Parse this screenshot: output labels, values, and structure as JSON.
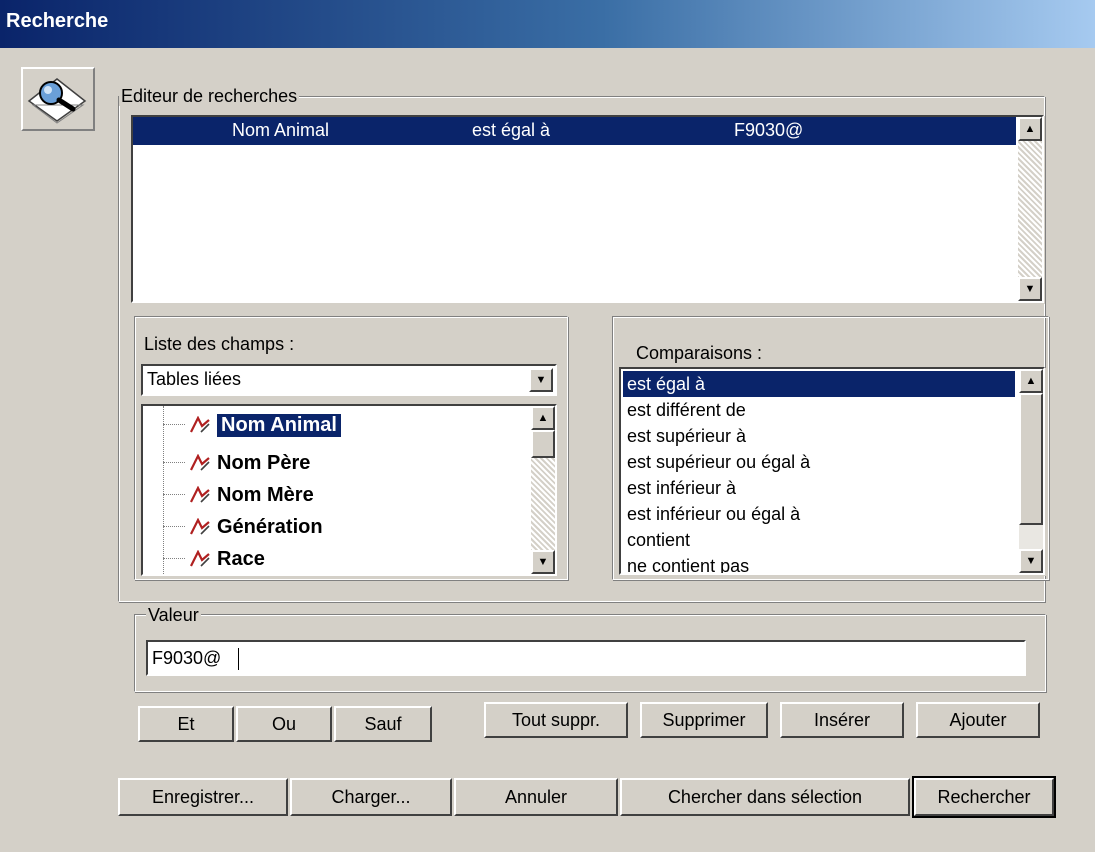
{
  "window": {
    "title": "Recherche"
  },
  "editor": {
    "label": "Editeur de recherches",
    "rows": [
      {
        "field": "Nom Animal",
        "operator": "est égal à",
        "value": "F9030@"
      }
    ]
  },
  "fields": {
    "label": "Liste des champs :",
    "dropdown_value": "Tables liées",
    "items": [
      "Nom Animal",
      "Nom Père",
      "Nom Mère",
      "Génération",
      "Race"
    ]
  },
  "comparisons": {
    "label": "Comparaisons :",
    "items": [
      "est égal à",
      "est différent de",
      "est supérieur à",
      "est supérieur ou égal à",
      "est inférieur à",
      "est inférieur ou égal à",
      "contient",
      "ne contient pas"
    ]
  },
  "value_group": {
    "label": "Valeur",
    "value": "F9030@"
  },
  "logic_buttons": {
    "et": "Et",
    "ou": "Ou",
    "sauf": "Sauf"
  },
  "edit_buttons": {
    "tout_suppr": "Tout suppr.",
    "supprimer": "Supprimer",
    "inserer": "Insérer",
    "ajouter": "Ajouter"
  },
  "bottom_buttons": {
    "enregistrer": "Enregistrer...",
    "charger": "Charger...",
    "annuler": "Annuler",
    "chercher_selection": "Chercher dans sélection",
    "rechercher": "Rechercher"
  },
  "colors": {
    "title_bar_start": "#0a246a",
    "selection": "#0a246a",
    "face": "#d4d0c8",
    "field_icon": "#b02020"
  },
  "icons": {
    "dialog": "magnifier-search-icon",
    "field": "field-link-icon"
  }
}
